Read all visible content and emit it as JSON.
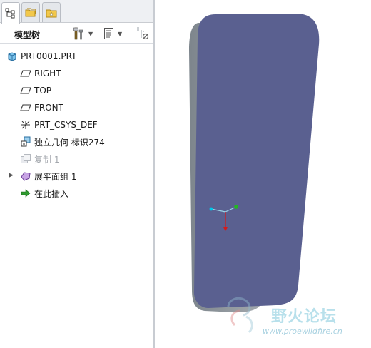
{
  "model_tree": {
    "title": "模型树",
    "items": [
      {
        "label": "PRT0001.PRT",
        "icon": "part-icon"
      },
      {
        "label": "RIGHT",
        "icon": "datum-plane-icon"
      },
      {
        "label": "TOP",
        "icon": "datum-plane-icon"
      },
      {
        "label": "FRONT",
        "icon": "datum-plane-icon"
      },
      {
        "label": "PRT_CSYS_DEF",
        "icon": "csys-icon"
      },
      {
        "label": "独立几何 标识274",
        "icon": "independent-geometry-icon"
      },
      {
        "label": "复制 1",
        "icon": "copy-icon"
      },
      {
        "label": "展平面组 1",
        "icon": "flatten-quilt-icon"
      },
      {
        "label": "在此插入",
        "icon": "insert-here-arrow-icon"
      }
    ]
  },
  "watermark": {
    "title": "野火论坛",
    "url": "www.proewildfire.cn"
  },
  "colors": {
    "surface_front": "#5a6090",
    "surface_back": "#8c939a",
    "csys_x": "#00c8e8",
    "csys_y": "#22b822",
    "csys_z": "#d81818"
  }
}
